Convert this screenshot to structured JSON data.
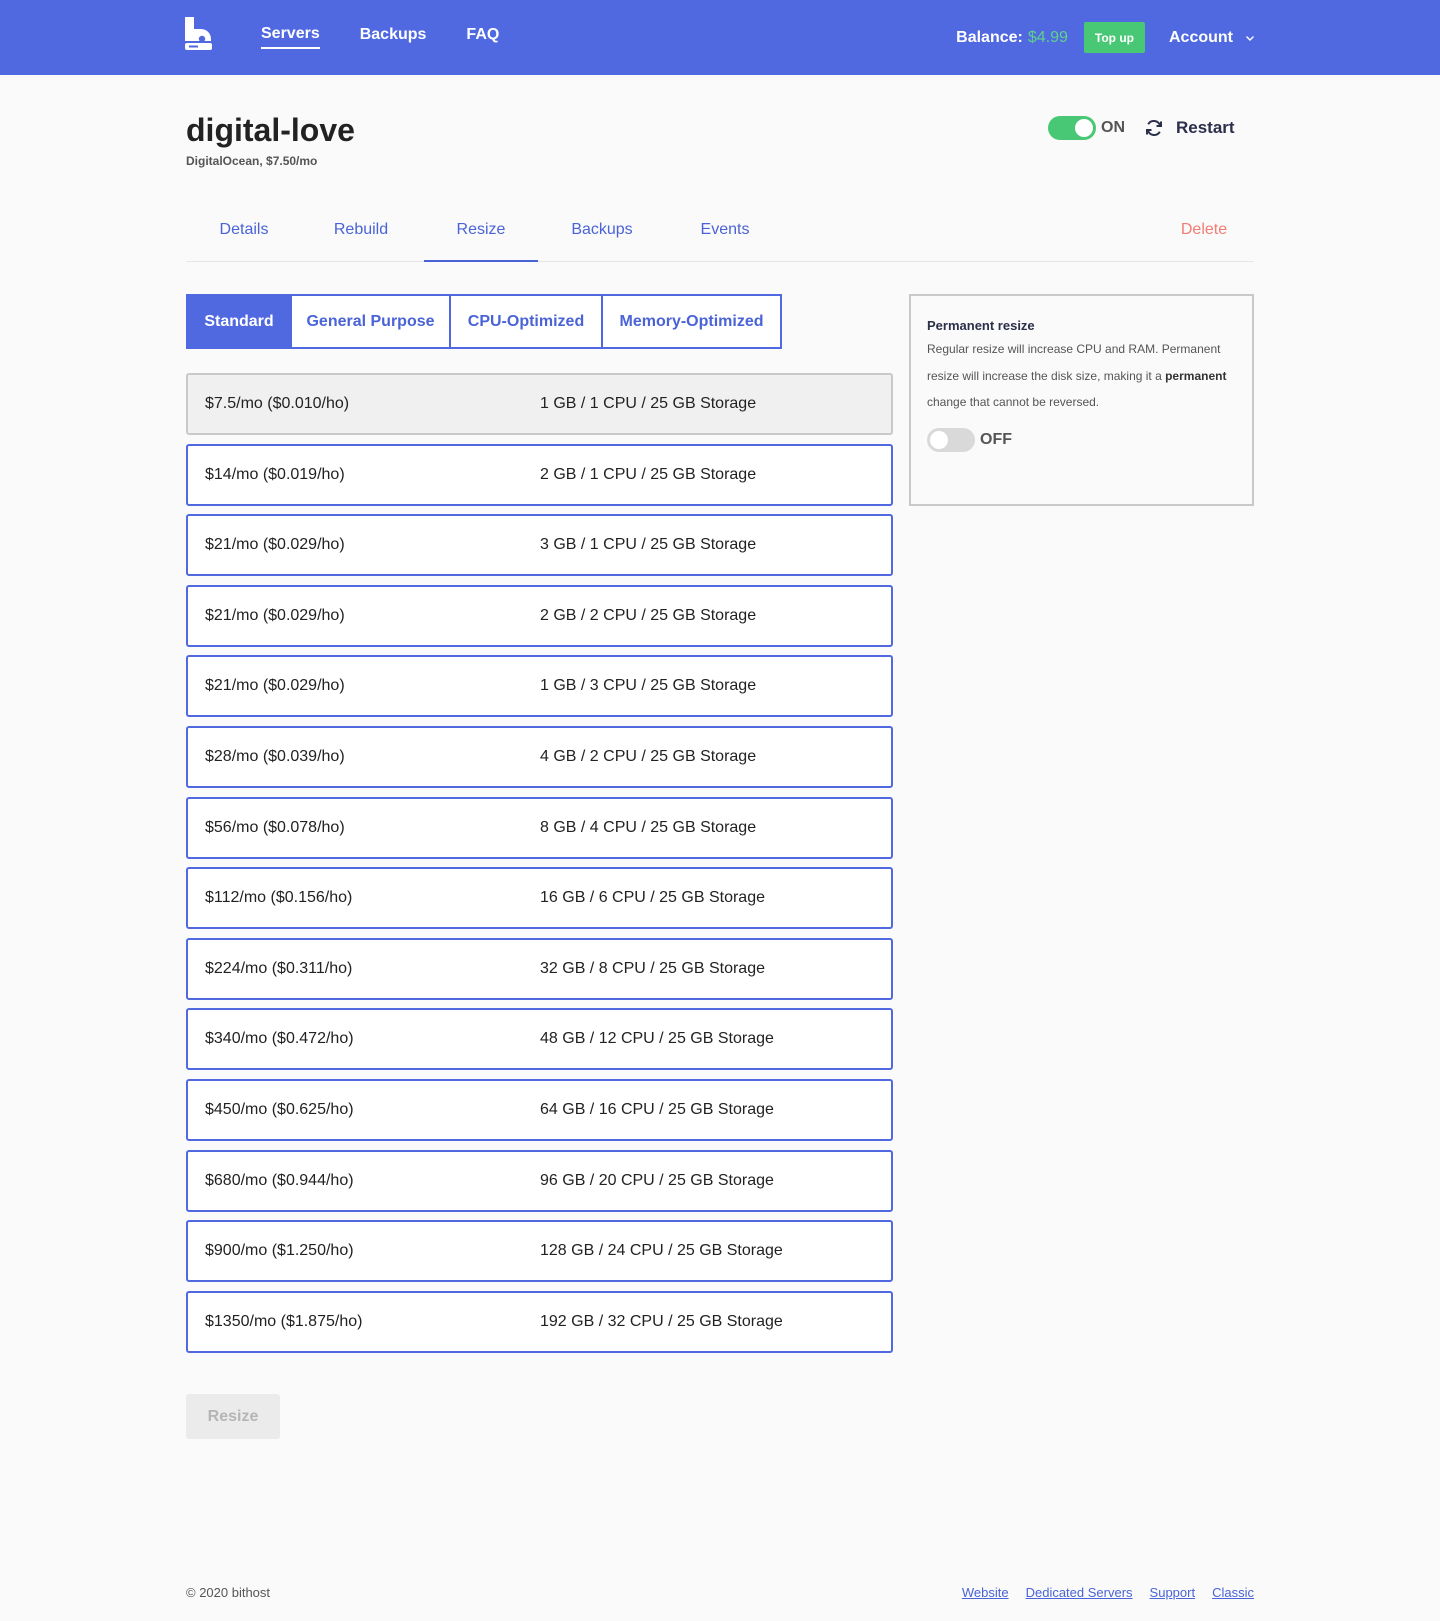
{
  "nav": {
    "items": [
      "Servers",
      "Backups",
      "FAQ"
    ],
    "balance_label": "Balance:",
    "balance_value": "$4.99",
    "topup_label": "Top up",
    "account_label": "Account"
  },
  "server": {
    "name": "digital-love",
    "subtitle": "DigitalOcean, $7.50/mo",
    "power_label": "ON",
    "power_on": true,
    "restart_label": "Restart"
  },
  "tabs": [
    "Details",
    "Rebuild",
    "Resize",
    "Backups",
    "Events"
  ],
  "active_tab": "Resize",
  "delete_label": "Delete",
  "categories": [
    "Standard",
    "General Purpose",
    "CPU-Optimized",
    "Memory-Optimized"
  ],
  "active_category": "Standard",
  "plans": [
    {
      "price": "$7.5/mo ($0.010/ho)",
      "spec": "1 GB / 1 CPU / 25 GB Storage",
      "current": true
    },
    {
      "price": "$14/mo ($0.019/ho)",
      "spec": "2 GB / 1 CPU / 25 GB Storage"
    },
    {
      "price": "$21/mo ($0.029/ho)",
      "spec": "3 GB / 1 CPU / 25 GB Storage"
    },
    {
      "price": "$21/mo ($0.029/ho)",
      "spec": "2 GB / 2 CPU / 25 GB Storage"
    },
    {
      "price": "$21/mo ($0.029/ho)",
      "spec": "1 GB / 3 CPU / 25 GB Storage"
    },
    {
      "price": "$28/mo ($0.039/ho)",
      "spec": "4 GB / 2 CPU / 25 GB Storage"
    },
    {
      "price": "$56/mo ($0.078/ho)",
      "spec": "8 GB / 4 CPU / 25 GB Storage"
    },
    {
      "price": "$112/mo ($0.156/ho)",
      "spec": "16 GB / 6 CPU / 25 GB Storage"
    },
    {
      "price": "$224/mo ($0.311/ho)",
      "spec": "32 GB / 8 CPU / 25 GB Storage"
    },
    {
      "price": "$340/mo ($0.472/ho)",
      "spec": "48 GB / 12 CPU / 25 GB Storage"
    },
    {
      "price": "$450/mo ($0.625/ho)",
      "spec": "64 GB / 16 CPU / 25 GB Storage"
    },
    {
      "price": "$680/mo ($0.944/ho)",
      "spec": "96 GB / 20 CPU / 25 GB Storage"
    },
    {
      "price": "$900/mo ($1.250/ho)",
      "spec": "128 GB / 24 CPU / 25 GB Storage"
    },
    {
      "price": "$1350/mo ($1.875/ho)",
      "spec": "192 GB / 32 CPU / 25 GB Storage"
    }
  ],
  "resize_button": "Resize",
  "permanent": {
    "title": "Permanent resize",
    "text_before": "Regular resize will increase CPU and RAM. Permanent resize will increase the disk size, making it a ",
    "text_bold": "permanent",
    "text_after": " change that cannot be reversed.",
    "switch_label": "OFF",
    "switch_on": false
  },
  "footer": {
    "copyright": "© 2020 bithost",
    "links": [
      "Website",
      "Dedicated Servers",
      "Support",
      "Classic"
    ]
  },
  "colors": {
    "brand": "#5069e0",
    "success": "#48c774",
    "danger": "#f27d74"
  },
  "icons": [
    "bithost-logo-icon",
    "chevron-down-icon",
    "refresh-icon"
  ]
}
